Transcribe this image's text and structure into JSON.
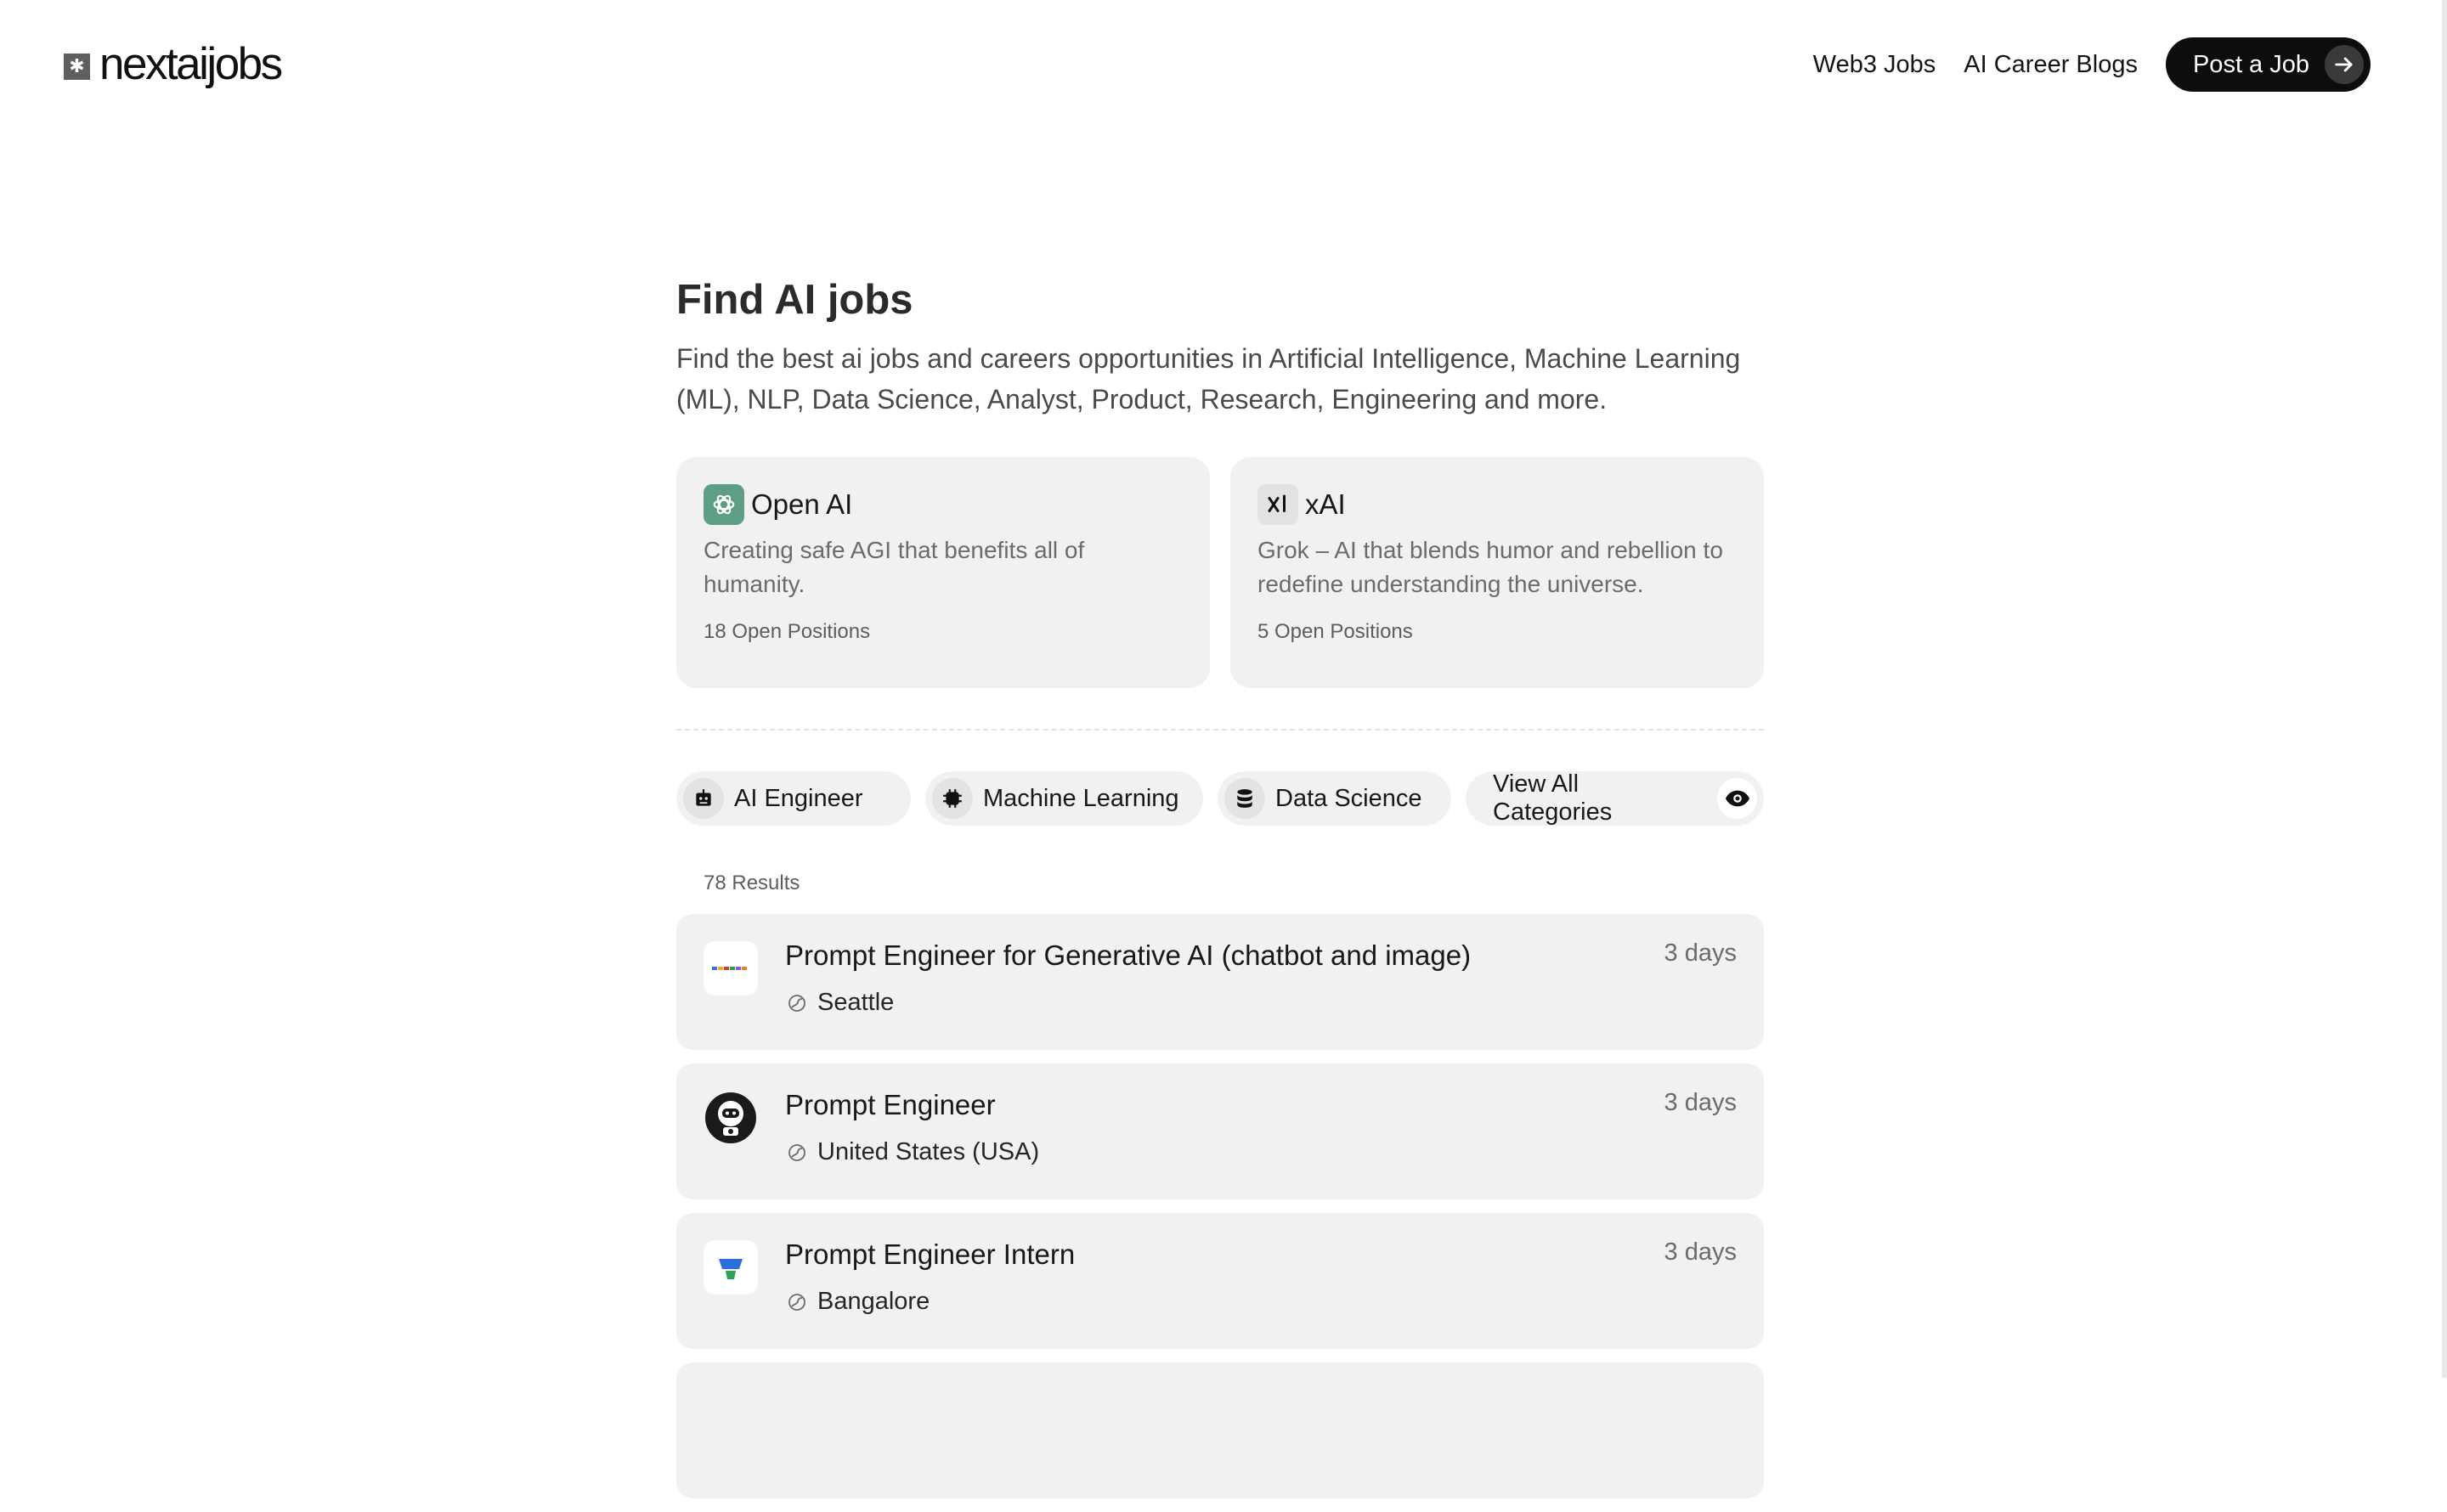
{
  "header": {
    "logo_text": "nextaijobs",
    "logo_icon": "asterisk-square-icon",
    "nav": [
      {
        "label": "Web3 Jobs"
      },
      {
        "label": "AI Career Blogs"
      }
    ],
    "post_button": "Post a Job"
  },
  "hero": {
    "title": "Find AI jobs",
    "description": "Find the best ai jobs and careers opportunities in Artificial Intelligence, Machine Learning (ML), NLP, Data Science, Analyst, Product, Research, Engineering and more."
  },
  "companies": [
    {
      "name": "Open AI",
      "description": "Creating safe AGI that benefits all of humanity.",
      "open_positions": "18 Open Positions",
      "logo_color": "#5d9e84"
    },
    {
      "name": "xAI",
      "description": "Grok – AI that blends humor and rebellion to redefine understanding the universe.",
      "open_positions": "5 Open Positions",
      "logo_color": "#e2e2e2"
    }
  ],
  "categories": [
    {
      "label": "AI Engineer",
      "icon": "robot-icon"
    },
    {
      "label": "Machine Learning",
      "icon": "chip-icon"
    },
    {
      "label": "Data Science",
      "icon": "database-icon"
    },
    {
      "label": "View All Categories",
      "icon": "eye-icon"
    }
  ],
  "results_count": "78 Results",
  "jobs": [
    {
      "title": "Prompt Engineer for Generative AI (chatbot and image)",
      "location": "Seattle",
      "posted": "3 days"
    },
    {
      "title": "Prompt Engineer",
      "location": "United States (USA)",
      "posted": "3 days"
    },
    {
      "title": "Prompt Engineer Intern",
      "location": "Bangalore",
      "posted": "3 days"
    }
  ],
  "colors": {
    "accent_dark": "#0d0d0d",
    "card_background": "#f1f1f1"
  }
}
